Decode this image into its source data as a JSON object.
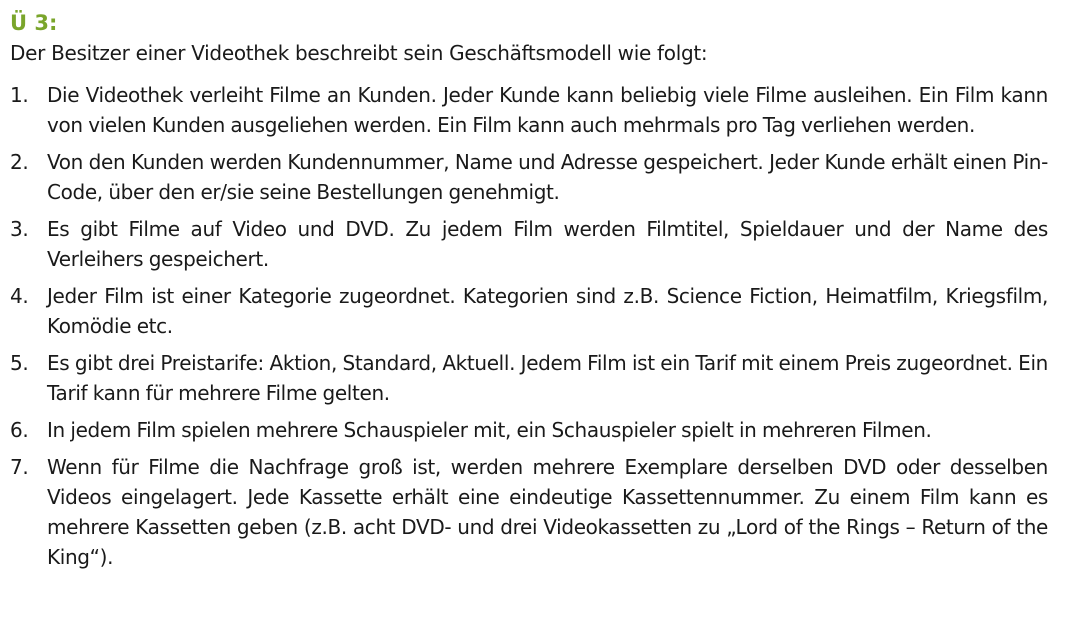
{
  "heading": {
    "text": "Ü 3:",
    "color": "#7aa52b"
  },
  "intro": "Der Besitzer einer Videothek beschreibt sein Geschäftsmodell wie folgt:",
  "items": [
    {
      "number": "1.",
      "text": "Die Videothek verleiht Filme an Kunden. Jeder Kunde kann beliebig viele Filme ausleihen. Ein Film kann von vielen Kunden ausgeliehen werden. Ein Film kann auch mehrmals pro Tag verliehen werden."
    },
    {
      "number": "2.",
      "text": "Von den Kunden werden Kundennummer, Name und Adresse gespeichert. Jeder Kunde erhält einen Pin-Code, über den er/sie seine Bestellungen genehmigt."
    },
    {
      "number": "3.",
      "text": "Es gibt Filme auf Video und DVD. Zu jedem Film werden Filmtitel, Spieldauer und der Name des Verleihers gespeichert."
    },
    {
      "number": "4.",
      "text": "Jeder Film ist einer Kategorie zugeordnet. Kategorien sind z.B. Science Fiction, Heimatfilm, Kriegsfilm, Komödie etc."
    },
    {
      "number": "5.",
      "text": "Es gibt drei Preistarife: Aktion, Standard, Aktuell. Jedem Film ist ein Tarif mit einem Preis zugeordnet. Ein Tarif kann für mehrere Filme gelten."
    },
    {
      "number": "6.",
      "text": "In jedem Film spielen mehrere Schauspieler mit, ein Schauspieler spielt in mehreren Filmen."
    },
    {
      "number": "7.",
      "text": "Wenn für Filme die Nachfrage groß ist, werden mehrere Exemplare derselben DVD oder desselben Videos eingelagert. Jede Kassette erhält eine eindeutige Kassettennummer. Zu einem Film kann es mehrere Kassetten geben (z.B. acht DVD- und drei Videokassetten zu „Lord of the Rings – Return of the King“)."
    }
  ]
}
